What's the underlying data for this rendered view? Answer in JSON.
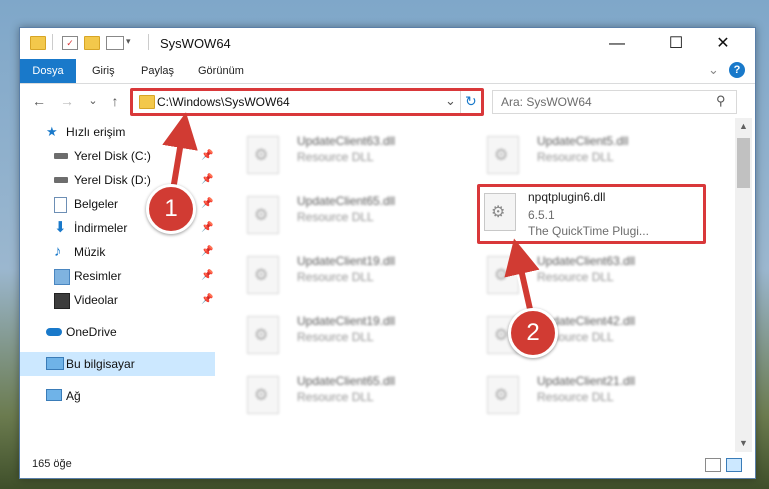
{
  "window": {
    "title": "SysWOW64",
    "min_glyph": "—",
    "max_glyph": "☐",
    "close_glyph": "✕"
  },
  "ribbon": {
    "tabs": [
      "Dosya",
      "Giriş",
      "Paylaş",
      "Görünüm"
    ],
    "chevron": "⌄",
    "help": "?"
  },
  "nav": {
    "back": "←",
    "forward": "→",
    "recent": "⌄",
    "up": "↑",
    "address": "C:\\Windows\\SysWOW64",
    "address_dropdown": "⌄",
    "refresh": "↻",
    "search_placeholder": "Ara: SysWOW64",
    "search_glyph": "⚲"
  },
  "sidebar": {
    "items": [
      {
        "label": "Hızlı erişim",
        "icon": "star-icon",
        "pinned": false
      },
      {
        "label": "Yerel Disk (C:)",
        "icon": "drive-icon",
        "pinned": true
      },
      {
        "label": "Yerel Disk (D:)",
        "icon": "drive-icon",
        "pinned": true
      },
      {
        "label": "Belgeler",
        "icon": "documents-icon",
        "pinned": true
      },
      {
        "label": "İndirmeler",
        "icon": "download-icon",
        "pinned": true
      },
      {
        "label": "Müzik",
        "icon": "music-icon",
        "pinned": true
      },
      {
        "label": "Resimler",
        "icon": "pictures-icon",
        "pinned": true
      },
      {
        "label": "Videolar",
        "icon": "video-icon",
        "pinned": true
      },
      {
        "label": "OneDrive",
        "icon": "cloud-icon",
        "pinned": false
      },
      {
        "label": "Bu bilgisayar",
        "icon": "computer-icon",
        "pinned": false,
        "selected": true
      },
      {
        "label": "Ağ",
        "icon": "network-icon",
        "pinned": false
      }
    ],
    "pin_glyph": "📌"
  },
  "files": {
    "left": [
      {
        "name": "UpdateClient63.dll",
        "desc": "Resource DLL"
      },
      {
        "name": "UpdateClient65.dll",
        "desc": "Resource DLL"
      },
      {
        "name": "UpdateClient19.dll",
        "desc": "Resource DLL"
      },
      {
        "name": "UpdateClient19.dll",
        "desc": "Resource DLL"
      },
      {
        "name": "UpdateClient65.dll",
        "desc": "Resource DLL"
      }
    ],
    "right": [
      {
        "name": "UpdateClient5.dll",
        "desc": "Resource DLL"
      },
      {
        "name": "npqtplugin6.dll",
        "version": "6.5.1",
        "desc": "The QuickTime Plugi...",
        "highlighted": true
      },
      {
        "name": "UpdateClient63.dll",
        "desc": "Resource DLL"
      },
      {
        "name": "UpdateClient42.dll",
        "desc": "Resource DLL"
      },
      {
        "name": "UpdateClient21.dll",
        "desc": "Resource DLL"
      }
    ]
  },
  "status": {
    "count": "165 öğe"
  },
  "callouts": {
    "one": "1",
    "two": "2",
    "color": "#d13b33"
  },
  "colors": {
    "accent": "#1979ca",
    "highlight_box": "#d9383a",
    "selection": "#cce8ff"
  }
}
